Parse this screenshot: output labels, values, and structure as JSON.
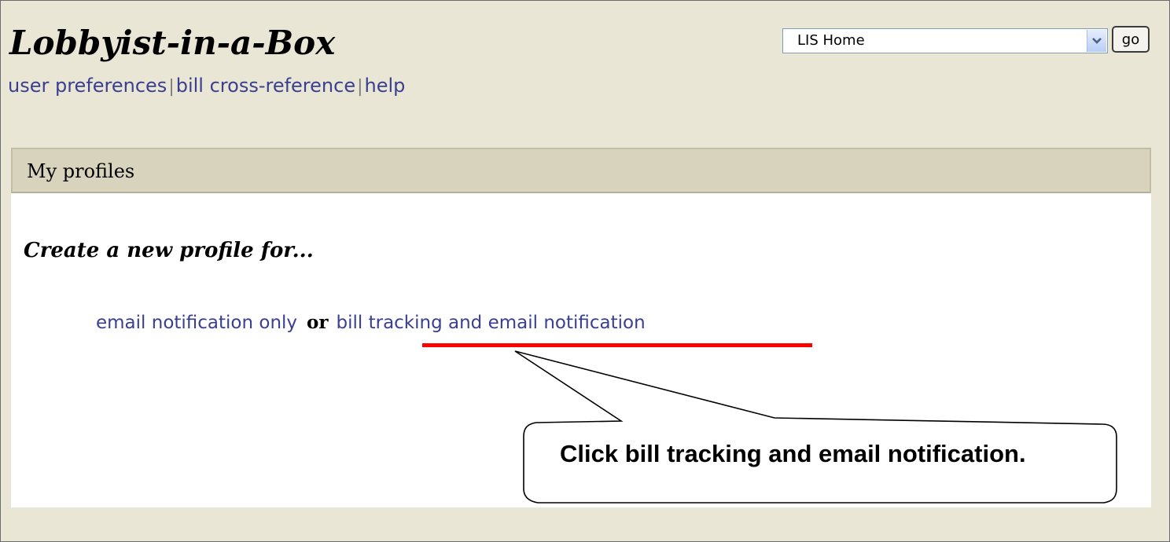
{
  "header": {
    "app_title": "Lobbyist-in-a-Box",
    "nav": [
      {
        "label": "user preferences"
      },
      {
        "label": "bill cross-reference"
      },
      {
        "label": "help"
      }
    ],
    "nav_separator": "|",
    "site_select": {
      "value": "LIS Home"
    },
    "go_label": "go"
  },
  "panel": {
    "header_label": "My profiles",
    "create_title": "Create a new profile for...",
    "options": {
      "email_only": "email notification only",
      "or_label": "or",
      "bill_tracking": "bill tracking and email notification"
    }
  },
  "callout": {
    "text": "Click bill tracking and email notification."
  },
  "colors": {
    "background": "#e9e6d6",
    "panel_header": "#d7d3bd",
    "link": "#3a3f8f",
    "highlight": "#ff0000"
  },
  "icons": {
    "dropdown": "chevron-down-icon"
  }
}
